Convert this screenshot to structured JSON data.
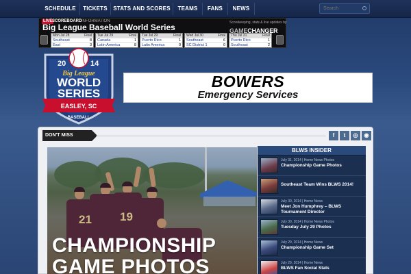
{
  "nav": {
    "items": [
      "SCHEDULE",
      "TICKETS",
      "STATS AND SCORES",
      "TEAMS",
      "FANS",
      "NEWS"
    ],
    "search_placeholder": "Search"
  },
  "scoreboard": {
    "live": "LIVE",
    "label": "SCOREBOARD",
    "info": "INFORMATION",
    "title": "Big League Baseball World Series",
    "tagline": "Scorekeeping, stats & live updates by",
    "brand_a": "GAME",
    "brand_b": "CHANGER",
    "games": [
      {
        "date": "Mon Jul 28",
        "status": "Final",
        "team1": "Southeast",
        "score1": "8",
        "team2": "East",
        "score2": "3"
      },
      {
        "date": "Tue Jul 29",
        "status": "Final",
        "team1": "Canada",
        "score1": "1",
        "team2": "Latin America",
        "score2": "8"
      },
      {
        "date": "Tue Jul 29",
        "status": "Final",
        "team1": "Puerto Rico",
        "score1": "1",
        "team2": "Latin America",
        "score2": "0"
      },
      {
        "date": "Wed Jul 30",
        "status": "Final",
        "team1": "Southeast",
        "score1": "6",
        "team2": "SC District 1",
        "score2": "0"
      },
      {
        "date": "Thu Jul 31",
        "status": "Final",
        "team1": "Puerto Rico",
        "score1": "1",
        "team2": "Southeast",
        "score2": "2"
      }
    ]
  },
  "logo": {
    "line1": "Big League",
    "line2": "WORLD",
    "line3": "SERIES",
    "location": "EASLEY, SC",
    "sport": "BASEBALL",
    "year_left": "20",
    "year_right": "14"
  },
  "sponsor": {
    "name": "BOWERS",
    "subtitle": "Emergency Services"
  },
  "panel": {
    "dont_miss": "DON'T MISS",
    "social_icons": [
      "facebook-icon",
      "twitter-icon",
      "instagram-icon",
      "rss-icon"
    ]
  },
  "feature": {
    "title": "CHAMPIONSHIP GAME PHOTOS",
    "jersey_numbers": [
      "21",
      "19"
    ]
  },
  "insider": {
    "heading": "BLWS INSIDER",
    "items": [
      {
        "meta": "July 31, 2014 | Home News Photos",
        "title": "Championship Game Photos",
        "thumb_color": "#6b3b4a"
      },
      {
        "meta": "",
        "title": "Southeast Team Wins BLWS 2014!",
        "thumb_color": "#7a3a3a"
      },
      {
        "meta": "July 30, 2014 | Home News",
        "title": "Meet Jon Humphrey – BLWS Tournament Director",
        "thumb_color": "#5a6a8a"
      },
      {
        "meta": "July 30, 2014 | Home News Photos",
        "title": "Tuesday July 29 Photos",
        "thumb_color": "#4a6a4a"
      },
      {
        "meta": "July 29, 2014 | Home News",
        "title": "Championship Game Set",
        "thumb_color": "#3a4a7a"
      },
      {
        "meta": "July 29, 2014 | Home News",
        "title": "BLWS Fan Social Stats",
        "thumb_color": "#c44"
      }
    ]
  }
}
